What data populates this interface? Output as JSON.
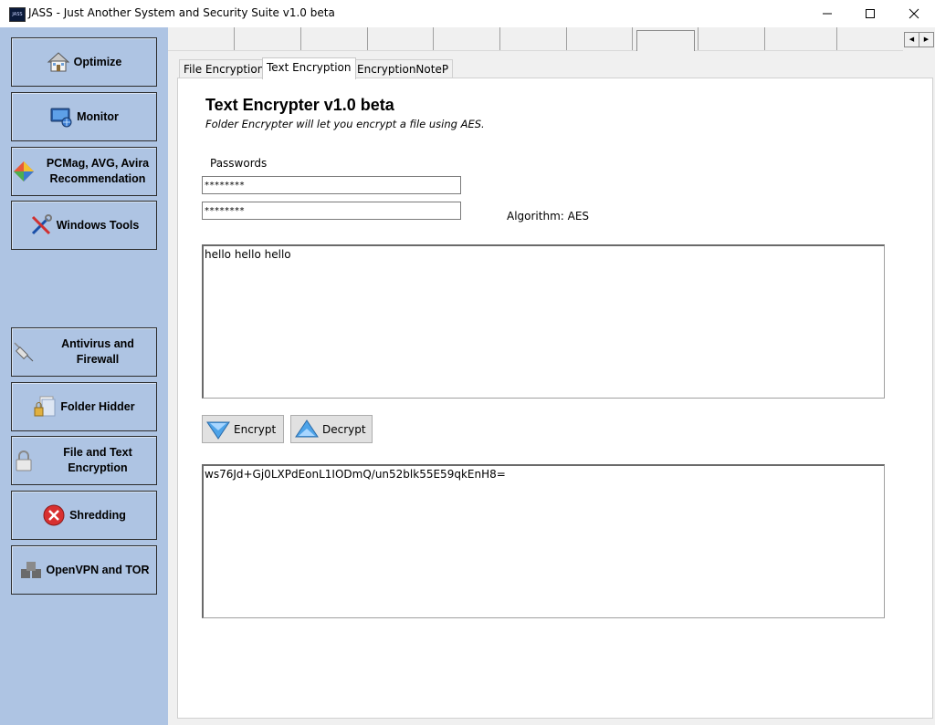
{
  "window": {
    "title": "JASS - Just Another System and Security Suite v1.0 beta",
    "icon_label": "JASS",
    "controls": {
      "minimize": "─",
      "maximize": "☐",
      "close": "✕"
    }
  },
  "sidebar": {
    "items": [
      {
        "label": "Optimize",
        "icon": "house-icon"
      },
      {
        "label": "Monitor",
        "icon": "monitor-icon"
      },
      {
        "label": "PCMag, AVG, Avira Recommendation",
        "icon": "diamond-icon"
      },
      {
        "label": "Windows Tools",
        "icon": "tools-icon"
      },
      {
        "label": "Antivirus and Firewall",
        "icon": "syringe-icon"
      },
      {
        "label": "Folder Hidder",
        "icon": "folder-lock-icon"
      },
      {
        "label": "File and Text Encryption",
        "icon": "padlock-icon"
      },
      {
        "label": "Shredding",
        "icon": "no-entry-icon"
      },
      {
        "label": "OpenVPN and TOR",
        "icon": "network-icon"
      }
    ]
  },
  "tabs": {
    "scroll_left": "◀",
    "scroll_right": "▶",
    "items": [
      {
        "label": "File Encryption",
        "selected": false
      },
      {
        "label": "Text Encryption",
        "selected": true
      },
      {
        "label": "EncryptionNoteP",
        "selected": false
      }
    ]
  },
  "encrypter": {
    "title": "Text Encrypter v1.0 beta",
    "subtitle": "Folder Encrypter will let you encrypt a file using AES.",
    "passwords_label": "Passwords",
    "password1": "********",
    "password2": "********",
    "algorithm_label": "Algorithm: AES",
    "input_text": "hello hello hello",
    "encrypt_label": "Encrypt",
    "decrypt_label": "Decrypt",
    "output_text": "ws76Jd+Gj0LXPdEonL1IODmQ/un52blk55E59qkEnH8="
  },
  "colors": {
    "sidebar_bg": "#aec4e3",
    "button_bg": "#e1e1e1",
    "panel_bg": "#ffffff"
  }
}
